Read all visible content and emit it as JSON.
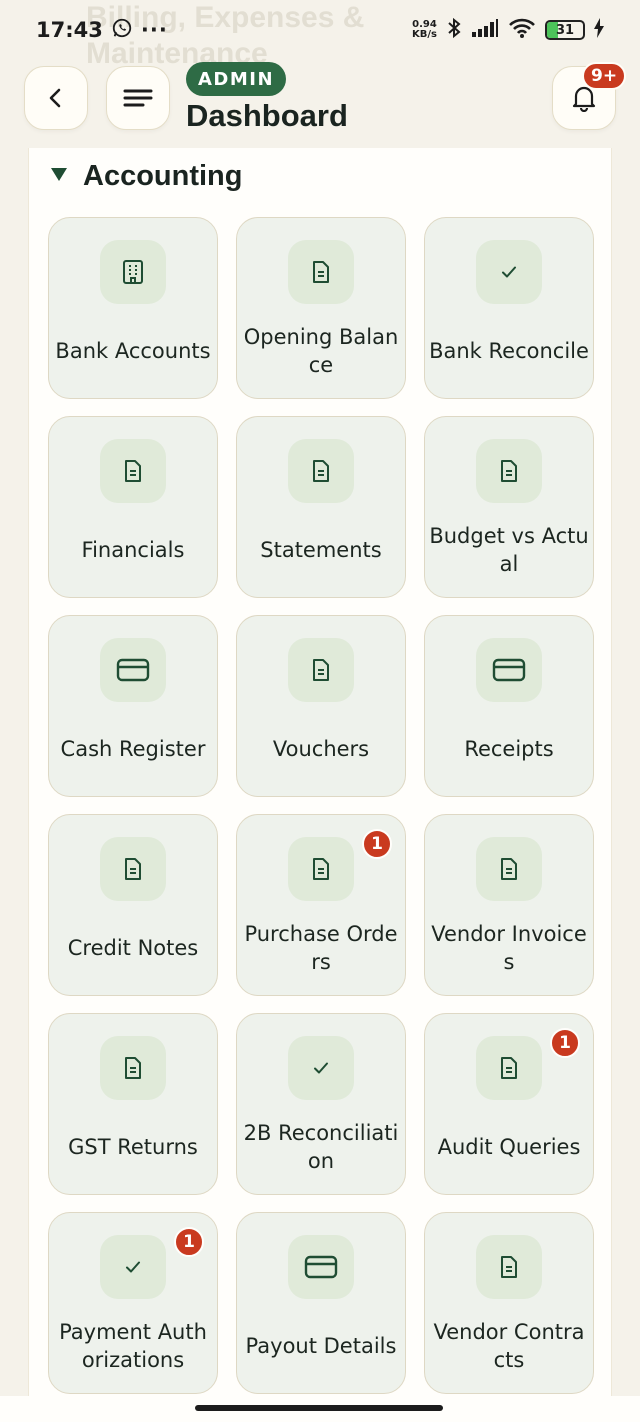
{
  "status_bar": {
    "time": "17:43",
    "net_speed_value": "0.94",
    "net_speed_unit": "KB/s",
    "battery_level": "31",
    "battery_fraction": 0.31
  },
  "ghost_title": "Billing, Expenses & Maintenance",
  "header": {
    "role_badge": "ADMIN",
    "title": "Dashboard",
    "notification_count": "9+"
  },
  "section": {
    "title": "Accounting",
    "expanded": true
  },
  "tiles": [
    {
      "label": "Bank Accounts",
      "icon": "building-icon",
      "badge": ""
    },
    {
      "label": "Opening Balance",
      "icon": "document-icon",
      "badge": ""
    },
    {
      "label": "Bank Reconcile",
      "icon": "check-icon",
      "badge": ""
    },
    {
      "label": "Financials",
      "icon": "document-icon",
      "badge": ""
    },
    {
      "label": "Statements",
      "icon": "document-icon",
      "badge": ""
    },
    {
      "label": "Budget vs Actual",
      "icon": "document-icon",
      "badge": ""
    },
    {
      "label": "Cash Register",
      "icon": "card-icon",
      "badge": ""
    },
    {
      "label": "Vouchers",
      "icon": "document-icon",
      "badge": ""
    },
    {
      "label": "Receipts",
      "icon": "card-icon",
      "badge": ""
    },
    {
      "label": "Credit Notes",
      "icon": "document-icon",
      "badge": ""
    },
    {
      "label": "Purchase Orders",
      "icon": "document-icon",
      "badge": "1"
    },
    {
      "label": "Vendor Invoices",
      "icon": "document-icon",
      "badge": ""
    },
    {
      "label": "GST Returns",
      "icon": "document-icon",
      "badge": ""
    },
    {
      "label": "2B Reconciliation",
      "icon": "check-icon",
      "badge": ""
    },
    {
      "label": "Audit Queries",
      "icon": "document-icon",
      "badge": "1"
    },
    {
      "label": "Payment Authorizations",
      "icon": "check-icon",
      "badge": "1"
    },
    {
      "label": "Payout Details",
      "icon": "card-icon",
      "badge": ""
    },
    {
      "label": "Vendor Contracts",
      "icon": "document-icon",
      "badge": ""
    }
  ],
  "colors": {
    "accent": "#2e6b45",
    "badge": "#c93a1f",
    "tile_bg": "#eef2ec",
    "icon_bg": "#e0ead9"
  }
}
